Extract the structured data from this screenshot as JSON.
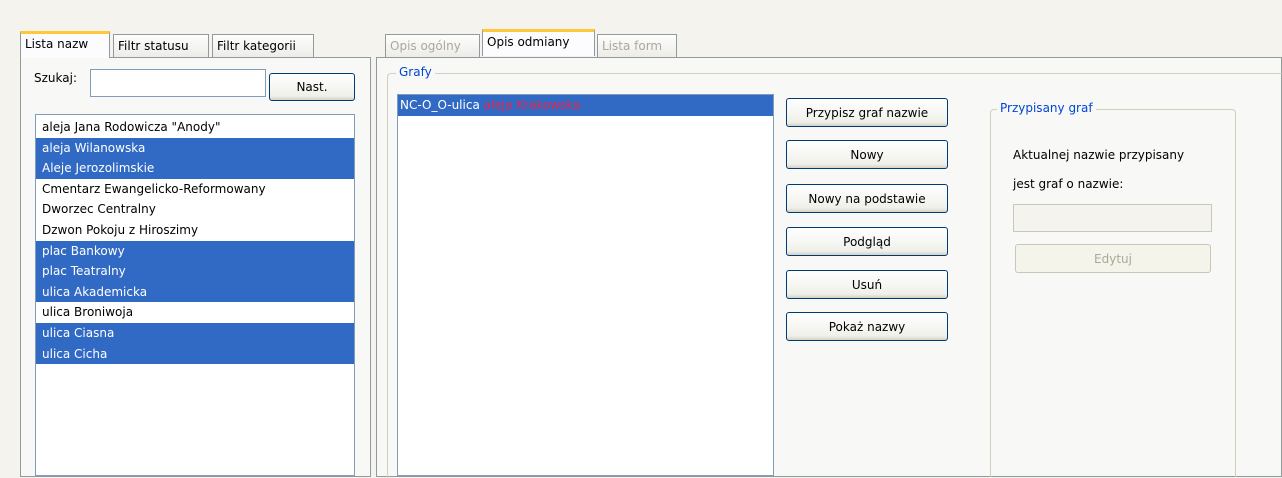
{
  "left_tabs": [
    {
      "label": "Lista nazw",
      "active": true
    },
    {
      "label": "Filtr statusu",
      "active": false
    },
    {
      "label": "Filtr kategorii",
      "active": false
    }
  ],
  "search": {
    "label": "Szukaj:",
    "value": "",
    "next_label": "Nast."
  },
  "names_list": [
    {
      "text": "aleja Jana Rodowicza \"Anody\"",
      "selected": false
    },
    {
      "text": "aleja Wilanowska",
      "selected": true
    },
    {
      "text": "Aleje Jerozolimskie",
      "selected": true
    },
    {
      "text": "Cmentarz Ewangelicko-Reformowany",
      "selected": false
    },
    {
      "text": "Dworzec Centralny",
      "selected": false
    },
    {
      "text": "Dzwon Pokoju z Hiroszimy",
      "selected": false
    },
    {
      "text": "plac Bankowy",
      "selected": true
    },
    {
      "text": "plac Teatralny",
      "selected": true
    },
    {
      "text": "ulica Akademicka",
      "selected": true
    },
    {
      "text": "ulica Broniwoja",
      "selected": false
    },
    {
      "text": "ulica Ciasna",
      "selected": true
    },
    {
      "text": "ulica Cicha",
      "selected": true
    }
  ],
  "right_tabs": [
    {
      "label": "Opis ogólny",
      "active": false,
      "disabled": true
    },
    {
      "label": "Opis odmiany",
      "active": true,
      "disabled": false
    },
    {
      "label": "Lista form",
      "active": false,
      "disabled": true
    }
  ],
  "grafy": {
    "title": "Grafy",
    "items": [
      {
        "code": "NC-O_O-ulica",
        "name": "aleja Krakowska",
        "name_color": "#e8274b"
      }
    ]
  },
  "buttons": {
    "assign": "Przypisz graf nazwie",
    "new": "Nowy",
    "new_based": "Nowy na podstawie",
    "preview": "Podgląd",
    "delete": "Usuń",
    "show_names": "Pokaż nazwy"
  },
  "assigned": {
    "title": "Przypisany graf",
    "text_line1": "Aktualnej nazwie przypisany",
    "text_line2": "jest graf o nazwie:",
    "value": "",
    "edit_label": "Edytuj"
  },
  "colors": {
    "selection": "#316ac5",
    "tab_highlight": "#ffc83c",
    "group_title": "#0046d5"
  }
}
